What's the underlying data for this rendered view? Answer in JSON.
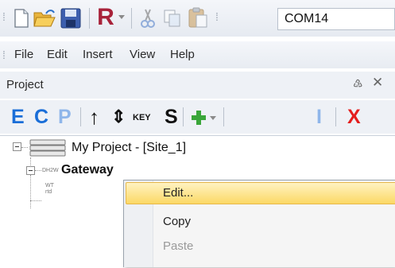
{
  "toolbar": {
    "com_port_value": "COM14",
    "icons": [
      "new-file-icon",
      "open-folder-icon",
      "save-icon",
      "r-icon",
      "dropdown-arrow-icon",
      "cut-icon",
      "copy-icon",
      "paste-icon"
    ],
    "r_label": "R"
  },
  "menu": {
    "items": [
      "File",
      "Edit",
      "Insert",
      "View",
      "Help"
    ]
  },
  "project_pane": {
    "title": "Project",
    "pin_glyph": "♵",
    "close_glyph": "✕",
    "toolbar": {
      "e_label": "E",
      "c_label": "C",
      "p_label": "P",
      "key_label": "KEY",
      "s_label": "S",
      "i_label": "I",
      "x_label": "X",
      "up_glyph": "↑",
      "updown_glyph": "⇕"
    }
  },
  "tree": {
    "root_label": "My Project - [Site_1]",
    "gateway_prefix": "DH2W",
    "gateway_label": "Gateway",
    "child_prefix_top": "WT",
    "child_prefix_bottom": "rtd"
  },
  "context_menu": {
    "items": [
      {
        "label": "Edit...",
        "enabled": true,
        "highlighted": true
      },
      {
        "label": "Copy",
        "enabled": true,
        "highlighted": false
      },
      {
        "label": "Paste",
        "enabled": false,
        "highlighted": false
      }
    ]
  },
  "colors": {
    "accent_blue": "#1a6ed8",
    "delete_red": "#e41e1e",
    "add_green": "#3aa63a",
    "highlight": "#fbd865"
  }
}
